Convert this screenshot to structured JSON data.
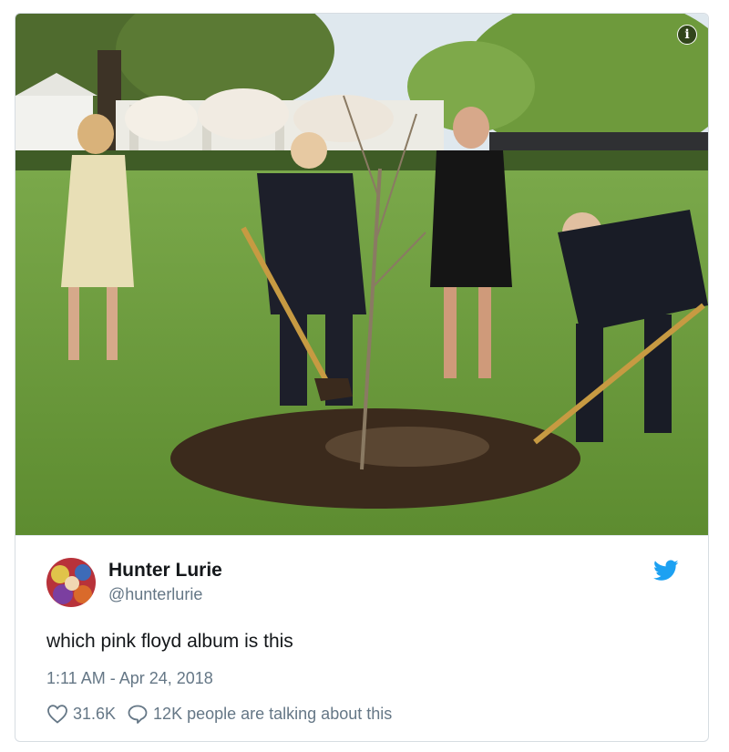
{
  "photo": {
    "alt_icon": "info-icon",
    "info_glyph": "i",
    "colors": {
      "lawn": "#6a9a3a",
      "soil": "#3b2a1c",
      "sky": "#dfe8ee"
    }
  },
  "tweet": {
    "author_name": "Hunter Lurie",
    "author_handle": "@hunterlurie",
    "text": "which pink floyd album is this",
    "timestamp": "1:11 AM - Apr 24, 2018",
    "likes": "31.6K",
    "replies_text": "12K people are talking about this",
    "brand_icon": "twitter-bird-icon",
    "brand_color": "#1da1f2"
  }
}
